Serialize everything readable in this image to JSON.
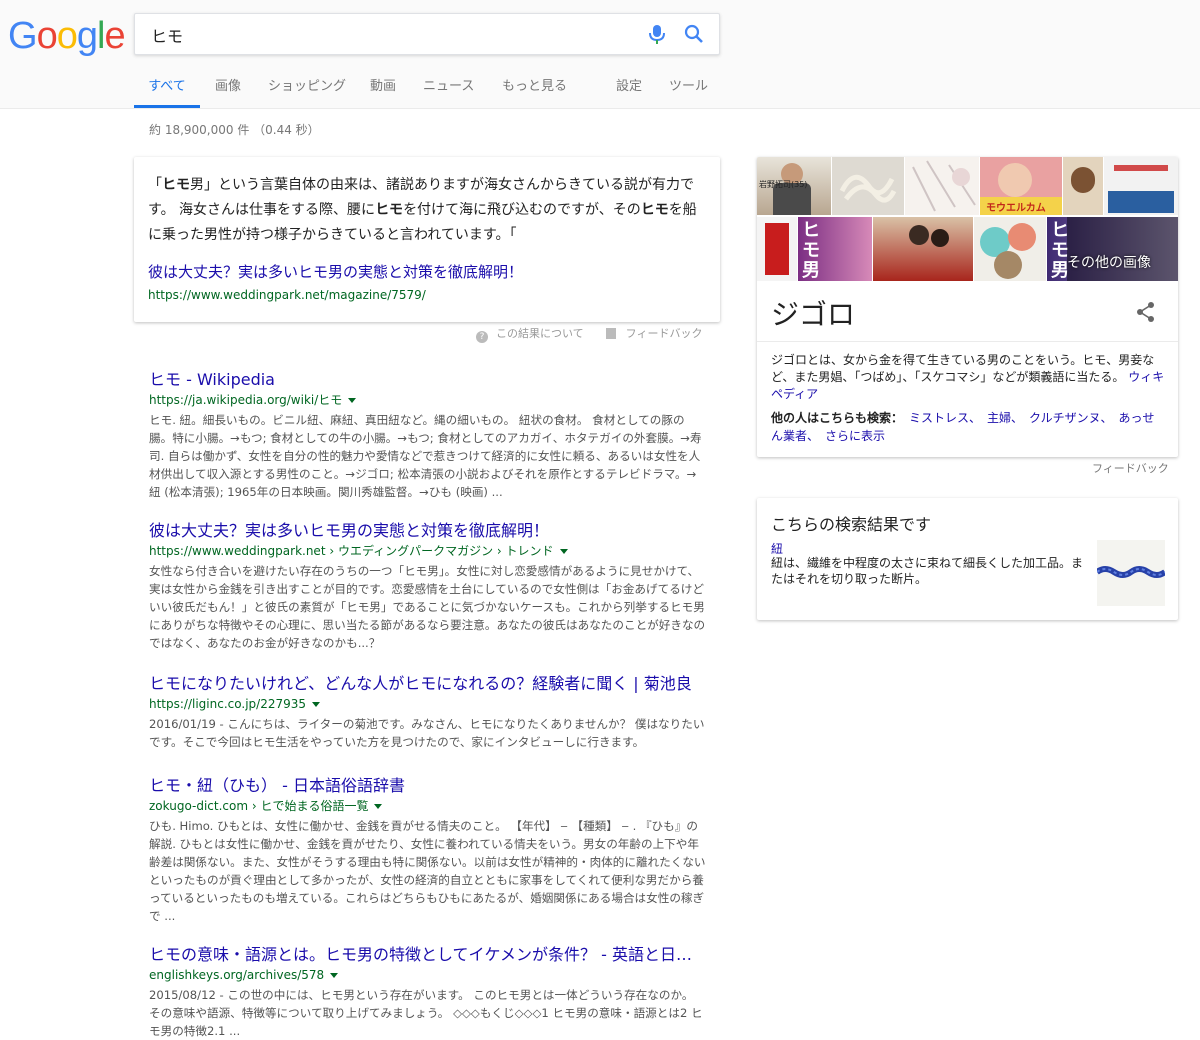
{
  "logo_text": [
    "G",
    "o",
    "o",
    "g",
    "l",
    "e"
  ],
  "search": {
    "query": "ヒモ"
  },
  "tabs": {
    "all": "すべて",
    "images": "画像",
    "shopping": "ショッピング",
    "videos": "動画",
    "news": "ニュース",
    "more": "もっと見る",
    "settings": "設定",
    "tools": "ツール"
  },
  "stats": "約 18,900,000 件 （0.44 秒）",
  "featured_snippet": {
    "text_html": "「<b>ヒモ</b>男」という言葉自体の由来は、諸説ありますが海女さんからきている説が有力です。 海女さんは仕事をする際、腰に<b>ヒモ</b>を付けて海に飛び込むのですが、その<b>ヒモ</b>を船に乗った男性が持つ様子からきていると言われています。「",
    "title": "彼は大丈夫？実は多いヒモ男の実態と対策を徹底解明！",
    "url": "https://www.weddingpark.net/magazine/7579/",
    "about_label": "この結果について",
    "feedback_label": "フィードバック"
  },
  "results": [
    {
      "title": "ヒモ - Wikipedia",
      "url": "https://ja.wikipedia.org/wiki/ヒモ",
      "snippet": "ヒモ. 紐。細長いもの。ビニル紐、麻紐、真田紐など。縄の細いもの。 紐状の食材。 食材としての豚の腸。特に小腸。→もつ; 食材としての牛の小腸。→もつ; 食材としてのアカガイ、ホタテガイの外套膜。→寿司. 自らは働かず、女性を自分の性的魅力や愛情などで惹きつけて経済的に女性に頼る、あるいは女性を人材供出して収入源とする男性のこと。→ジゴロ; 松本清張の小説およびそれを原作とするテレビドラマ。→紐 (松本清張); 1965年の日本映画。関川秀雄監督。→ひも (映画) ..."
    },
    {
      "title": "彼は大丈夫？実は多いヒモ男の実態と対策を徹底解明！",
      "url": "https://www.weddingpark.net › ウエディングパークマガジン › トレンド",
      "snippet": "女性なら付き合いを避けたい存在のうちの一つ「ヒモ男」。女性に対し恋愛感情があるように見せかけて、実は女性から金銭を引き出すことが目的です。恋愛感情を土台にしているので女性側は「お金あげてるけどいい彼氏だもん！」と彼氏の素質が「ヒモ男」であることに気づかないケースも。これから列挙するヒモ男にありがちな特徴やその心理に、思い当たる節があるなら要注意。あなたの彼氏はあなたのことが好きなのではなく、あなたのお金が好きなのかも...？"
    },
    {
      "title": "ヒモになりたいけれど、どんな人がヒモになれるの？経験者に聞く | 菊池良",
      "url": "https://liginc.co.jp/227935",
      "snippet": "2016/01/19 - こんにちは、ライターの菊池です。みなさん、ヒモになりたくありませんか？ 僕はなりたいです。そこで今回はヒモ生活をやっていた方を見つけたので、家にインタビューしに行きます。"
    },
    {
      "title": "ヒモ・紐（ひも） - 日本語俗語辞書",
      "url": "zokugo-dict.com › ヒで始まる俗語一覧",
      "snippet": "ひも. Himo. ひもとは、女性に働かせ、金銭を貢がせる情夫のこと。 【年代】 ‒ 【種類】 ‒ . 『ひも』の解説. ひもとは女性に働かせ、金銭を貢がせたり、女性に養われている情夫をいう。男女の年齢の上下や年齢差は関係ない。また、女性がそうする理由も特に関係ない。以前は女性が精神的・肉体的に離れたくないといったものが貢ぐ理由として多かったが、女性の経済的自立とともに家事をしてくれて便利な男だから養っているといったものも増えている。これらはどちらもひもにあたるが、婚姻関係にある場合は女性の稼ぎで ..."
    },
    {
      "title": "ヒモの意味・語源とは。ヒモ男の特徴としてイケメンが条件？ - 英語と日本語",
      "url": "englishkeys.org/archives/578",
      "snippet": "2015/08/12 - この世の中には、ヒモ男という存在がいます。 このヒモ男とは一体どういう存在なのか。 その意味や語源、特徴等について取り上げてみましょう。 ◇◇◇もくじ◇◇◇1 ヒモ男の意味・語源とは2 ヒモ男の特徴2.1 ..."
    }
  ],
  "knowledge_panel": {
    "more_images": "その他の画像",
    "image_labels": [
      "岩野拓司(35)",
      "モウエルカム",
      "ヒモ男",
      "ヒモ男"
    ],
    "title": "ジゴロ",
    "description": "ジゴロとは、女から金を得て生きている男のことをいう。ヒモ、男妾など、また男娼、「つばめ」、「スケコマシ」などが類義語に当たる。",
    "source": "ウィキペディア",
    "also_label": "他の人はこちらも検索：",
    "also_items": [
      "ミストレス、",
      "主婦、",
      "クルチザンヌ、",
      "あっせん業者、",
      "さらに表示"
    ],
    "feedback": "フィードバック"
  },
  "related_card": {
    "title": "こちらの検索結果です",
    "link": "紐",
    "description": "紐は、繊維を中程度の太さに束ねて細長くした加工品。またはそれを切り取った断片。"
  },
  "colors": {
    "link": "#1a0dab",
    "url": "#006621",
    "active_tab": "#1a73e8",
    "snippet_text": "#545454"
  }
}
